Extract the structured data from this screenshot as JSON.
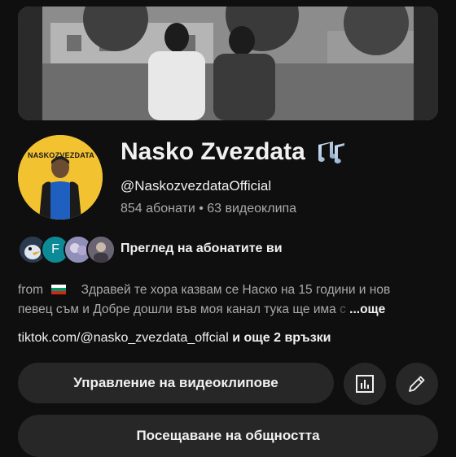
{
  "channel": {
    "name": "Nasko Zvezdata",
    "handle": "@NaskozvezdataOfficial",
    "stats": "854 абонати • 63 видеоклипа",
    "avatar_text_left": "NASKO",
    "avatar_text_right": "ZVEZDATA"
  },
  "subscribers": {
    "mini_avatar_letter": "F",
    "label": "Преглед на абонатите ви"
  },
  "description": {
    "line1_prefix": "from",
    "line1_text": "Здравей те хора казвам се   Наско на 15 години и нов",
    "line2_text": "певец съм и Добре дошли във моя канал тука ще има",
    "line2_fade": " с",
    "more": "...още"
  },
  "links": {
    "main": "tiktok.com/@nasko_zvezdata_offcial",
    "more": " и още 2 връзки"
  },
  "buttons": {
    "manage": "Управление на видеоклипове",
    "community": "Посещаване на общността"
  },
  "icons": {
    "music": "music-notes-icon",
    "analytics": "bar-chart-icon",
    "edit": "pencil-icon",
    "flag": "bulgaria-flag-icon"
  },
  "colors": {
    "background": "#0f0f0f",
    "button": "#272727",
    "secondary_text": "#aaaaaa",
    "avatar_bg": "#f2c230"
  }
}
